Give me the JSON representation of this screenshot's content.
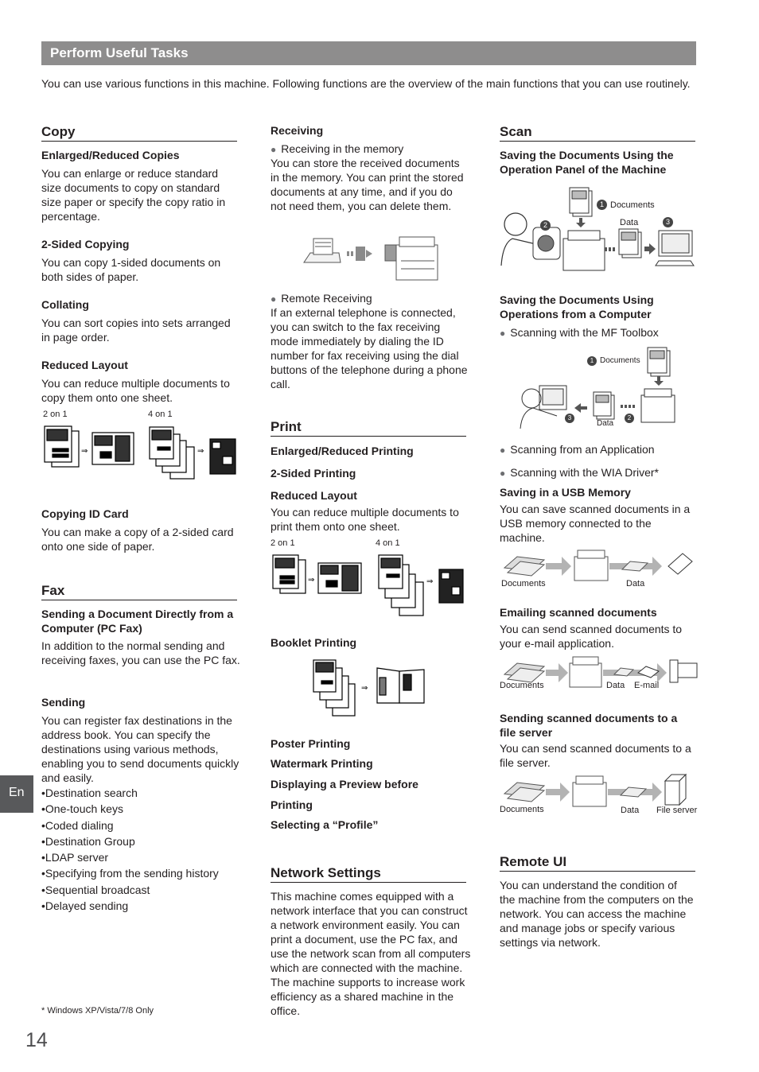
{
  "header": {
    "title": "Perform Useful Tasks",
    "intro": "You can use various functions in this machine. Following functions are the overview of the main functions that you can use routinely."
  },
  "copy": {
    "heading": "Copy",
    "items": [
      {
        "title": "Enlarged/Reduced Copies",
        "text": "You can enlarge or reduce standard size documents to copy on standard size paper or specify the copy ratio in percentage."
      },
      {
        "title": "2-Sided Copying",
        "text": "You can copy 1-sided documents on both sides of paper."
      },
      {
        "title": "Collating",
        "text": "You can sort copies into sets arranged in page order."
      },
      {
        "title": "Reduced Layout",
        "text": "You can reduce multiple documents to copy them onto one sheet."
      },
      {
        "title": "Copying ID Card",
        "text": "You can make a copy of a 2-sided card onto one side of paper."
      }
    ],
    "layout_labels": [
      "2 on 1",
      "4 on 1"
    ]
  },
  "fax": {
    "heading": "Fax",
    "items": [
      {
        "title": "Sending a Document Directly from a Computer (PC Fax)",
        "text": "In addition to the normal sending and receiving faxes, you can use the PC fax."
      },
      {
        "title": "Sending",
        "text": "You can register fax destinations in the address book. You can specify the destinations using various methods, enabling you to send documents quickly and easily."
      }
    ],
    "sending_methods": [
      "Destination search",
      "One-touch keys",
      "Coded dialing",
      "Destination Group",
      "LDAP server",
      "Specifying from the sending history",
      "Sequential broadcast",
      "Delayed sending"
    ]
  },
  "receiving": {
    "title": "Receiving",
    "memory_label": "Receiving in the memory",
    "memory_text": "You can store the received documents in the memory. You can print the stored documents at any time, and if you do not need them, you can delete them.",
    "remote_label": "Remote Receiving",
    "remote_text": "If an external telephone is connected, you can switch to the fax receiving mode immediately by dialing the ID number for fax receiving using the dial buttons of the telephone during a phone call."
  },
  "print": {
    "heading": "Print",
    "item1": "Enlarged/Reduced Printing",
    "item2": "2-Sided Printing",
    "item3": "Reduced Layout",
    "item3_text": "You can reduce multiple documents to print them onto one sheet.",
    "layout_labels": [
      "2 on 1",
      "4 on 1"
    ],
    "booklet": "Booklet Printing",
    "more": [
      "Poster Printing",
      "Watermark Printing",
      "Displaying a Preview before",
      "Printing",
      "Selecting a “Profile”"
    ]
  },
  "network": {
    "heading": "Network Settings",
    "text": "This machine comes equipped with a network interface that you can construct a network environment easily. You can print a document, use the PC fax, and use the network scan from all computers which are connected with the machine. The machine supports to increase work efficiency as a shared machine in the office."
  },
  "scan": {
    "heading": "Scan",
    "panel_title": "Saving the Documents Using the Operation Panel of the Machine",
    "panel_labels": {
      "documents": "Documents",
      "data": "Data",
      "step1": "1",
      "step2": "2",
      "step3": "3"
    },
    "computer_title": "Saving the Documents Using Operations from a Computer",
    "toolbox": "Scanning with the MF Toolbox",
    "computer_labels": {
      "documents": "Documents",
      "data": "Data",
      "step1": "1",
      "step2": "2",
      "step3": "3"
    },
    "from_app": "Scanning from an Application",
    "wia": "Scanning with the WIA Driver*",
    "usb_title": "Saving in a USB Memory",
    "usb_text": "You can save scanned documents in a USB memory connected to the machine.",
    "usb_labels": {
      "documents": "Documents",
      "data": "Data"
    },
    "email_title": "Emailing scanned documents",
    "email_text": "You can send scanned documents to your e-mail application.",
    "email_labels": {
      "documents": "Documents",
      "data": "Data",
      "email": "E-mail"
    },
    "server_title": "Sending scanned documents to a file server",
    "server_text": "You can send scanned documents to a file server.",
    "server_labels": {
      "documents": "Documents",
      "data": "Data",
      "server": "File server"
    }
  },
  "remote_ui": {
    "heading": "Remote UI",
    "text": "You can understand the condition of the machine from the computers on the network. You can access the machine and manage jobs or specify various settings via network."
  },
  "footnote": "* Windows XP/Vista/7/8 Only",
  "page_number": "14",
  "language_tab": "En"
}
